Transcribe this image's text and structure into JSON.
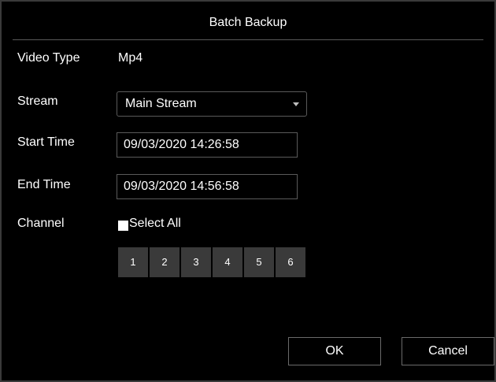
{
  "dialog": {
    "title": "Batch Backup"
  },
  "form": {
    "video_type_label": "Video Type",
    "video_type_value": "Mp4",
    "stream_label": "Stream",
    "stream_value": "Main Stream",
    "start_time_label": "Start Time",
    "start_time_value": "09/03/2020 14:26:58",
    "end_time_label": "End Time",
    "end_time_value": "09/03/2020 14:56:58",
    "channel_label": "Channel",
    "select_all_label": "Select All",
    "select_all_checked": false,
    "channels": [
      "1",
      "2",
      "3",
      "4",
      "5",
      "6"
    ]
  },
  "buttons": {
    "ok_label": "OK",
    "cancel_label": "Cancel"
  },
  "colors": {
    "background": "#000000",
    "border": "#5a5a5a",
    "channel_button": "#3a3a3a",
    "text": "#ffffff"
  }
}
